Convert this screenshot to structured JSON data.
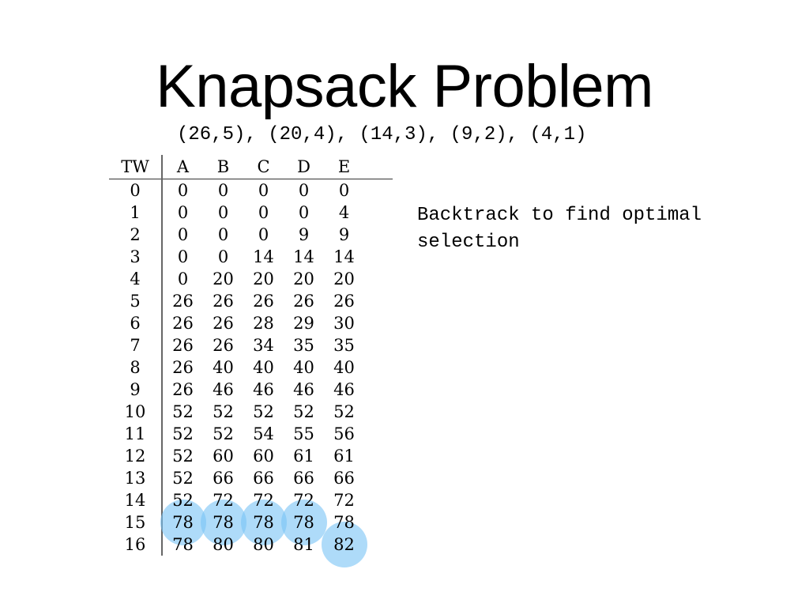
{
  "slide": {
    "title": "Knapsack Problem",
    "items_text": "(26,5), (20,4), (14,3), (9,2), (4,1)",
    "note": "Backtrack to find optimal\nselection",
    "highlight_color": "#78C3F5"
  },
  "table": {
    "headers": [
      "TW",
      "A",
      "B",
      "C",
      "D",
      "E"
    ],
    "rows": [
      {
        "tw": "0",
        "cells": [
          "0",
          "0",
          "0",
          "0",
          "0"
        ]
      },
      {
        "tw": "1",
        "cells": [
          "0",
          "0",
          "0",
          "0",
          "4"
        ]
      },
      {
        "tw": "2",
        "cells": [
          "0",
          "0",
          "0",
          "9",
          "9"
        ]
      },
      {
        "tw": "3",
        "cells": [
          "0",
          "0",
          "14",
          "14",
          "14"
        ]
      },
      {
        "tw": "4",
        "cells": [
          "0",
          "20",
          "20",
          "20",
          "20"
        ]
      },
      {
        "tw": "5",
        "cells": [
          "26",
          "26",
          "26",
          "26",
          "26"
        ]
      },
      {
        "tw": "6",
        "cells": [
          "26",
          "26",
          "28",
          "29",
          "30"
        ]
      },
      {
        "tw": "7",
        "cells": [
          "26",
          "26",
          "34",
          "35",
          "35"
        ]
      },
      {
        "tw": "8",
        "cells": [
          "26",
          "40",
          "40",
          "40",
          "40"
        ]
      },
      {
        "tw": "9",
        "cells": [
          "26",
          "46",
          "46",
          "46",
          "46"
        ]
      },
      {
        "tw": "10",
        "cells": [
          "52",
          "52",
          "52",
          "52",
          "52"
        ]
      },
      {
        "tw": "11",
        "cells": [
          "52",
          "52",
          "54",
          "55",
          "56"
        ]
      },
      {
        "tw": "12",
        "cells": [
          "52",
          "60",
          "60",
          "61",
          "61"
        ]
      },
      {
        "tw": "13",
        "cells": [
          "52",
          "66",
          "66",
          "66",
          "66"
        ]
      },
      {
        "tw": "14",
        "cells": [
          "52",
          "72",
          "72",
          "72",
          "72"
        ]
      },
      {
        "tw": "15",
        "cells": [
          "78",
          "78",
          "78",
          "78",
          "78"
        ]
      },
      {
        "tw": "16",
        "cells": [
          "78",
          "80",
          "80",
          "81",
          "82"
        ]
      }
    ],
    "highlighted": [
      {
        "row": 15,
        "col": 0
      },
      {
        "row": 15,
        "col": 1
      },
      {
        "row": 15,
        "col": 2
      },
      {
        "row": 15,
        "col": 3
      },
      {
        "row": 16,
        "col": 4
      }
    ]
  }
}
